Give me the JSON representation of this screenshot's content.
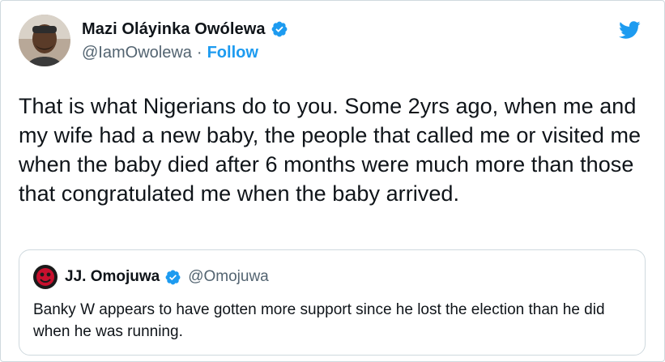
{
  "tweet": {
    "author": {
      "display_name": "Mazi Oláyinka Owólewa",
      "handle": "@IamOwolewa",
      "verified": true,
      "avatar": "profile-photo"
    },
    "separator": "·",
    "follow_label": "Follow",
    "text": "That is what Nigerians do to you. Some 2yrs ago, when me and my wife had a new baby, the people that called me or visited me when the baby died after 6 months were much more than those that congratulated me when the baby arrived.",
    "platform_icon": "twitter-bird-icon"
  },
  "quoted_tweet": {
    "author": {
      "display_name": "JJ. Omojuwa",
      "handle": "@Omojuwa",
      "verified": true,
      "avatar": "profile-photo"
    },
    "text": "Banky W appears to have gotten more support since he lost the election than he did when he was running."
  },
  "colors": {
    "accent": "#1d9bf0",
    "text_primary": "#0f1419",
    "text_secondary": "#536471",
    "border": "#cfd9de",
    "background": "#ffffff"
  }
}
